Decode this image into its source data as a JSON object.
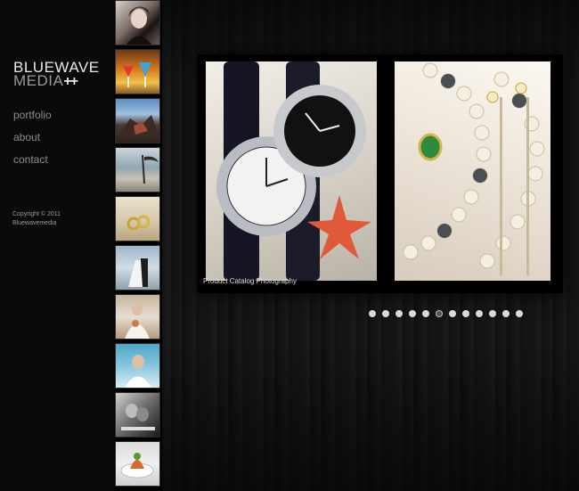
{
  "brand": {
    "line1": "BLUEWAVE",
    "line2": "MEDIA",
    "plus": "++"
  },
  "nav": [
    {
      "label": "portfolio"
    },
    {
      "label": "about"
    },
    {
      "label": "contact"
    }
  ],
  "copyright": {
    "line1": "Copyright © 2011",
    "line2": "Bluewavemedia"
  },
  "thumbnails": [
    {
      "icon": "portrait-woman-thumbnail"
    },
    {
      "icon": "cocktails-thumbnail"
    },
    {
      "icon": "rocks-thumbnail"
    },
    {
      "icon": "beach-thumbnail"
    },
    {
      "icon": "rings-thumbnail"
    },
    {
      "icon": "wedding-couple-thumbnail"
    },
    {
      "icon": "bride-thumbnail"
    },
    {
      "icon": "bride-veil-thumbnail"
    },
    {
      "icon": "couple-bw-thumbnail"
    },
    {
      "icon": "food-plate-thumbnail"
    }
  ],
  "slideshow": {
    "caption": "Product Catalog Photography",
    "dot_count": 12,
    "active_dot": 6
  },
  "colors": {
    "background": "#0b0b0b",
    "text": "#8c8c8c",
    "brand": "#e8e8e8"
  }
}
